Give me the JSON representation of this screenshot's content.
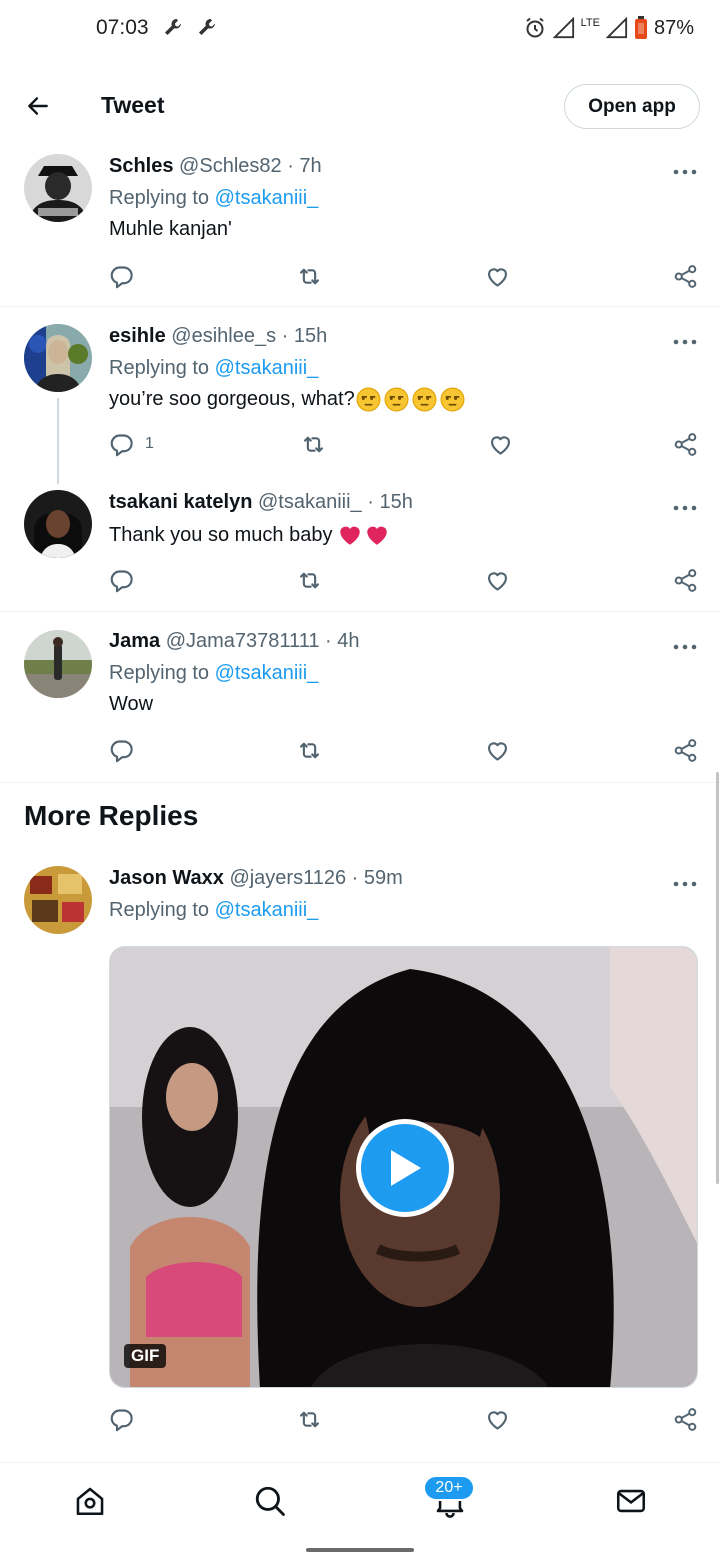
{
  "status_bar": {
    "time": "07:03",
    "battery": "87%",
    "network": "LTE"
  },
  "header": {
    "title": "Tweet",
    "open_app_label": "Open app"
  },
  "tweets": [
    {
      "name": "Schles",
      "handle": "@Schles82",
      "time": "· 7h",
      "replying_prefix": "Replying to ",
      "replying_handle": "@tsakaniii_",
      "text": "Muhle kanjan'",
      "reply_count": ""
    },
    {
      "name": "esihle",
      "handle": "@esihlee_s",
      "time": "· 15h",
      "replying_prefix": "Replying to ",
      "replying_handle": "@tsakaniii_",
      "text": "you’re soo gorgeous, what?",
      "emoji_count": 4,
      "reply_count": "1"
    },
    {
      "name": "tsakani katelyn",
      "handle": "@tsakaniii_",
      "time": "· 15h",
      "text": "Thank you so much baby",
      "hearts": 2,
      "reply_count": ""
    },
    {
      "name": "Jama",
      "handle": "@Jama73781111",
      "time": "· 4h",
      "replying_prefix": "Replying to ",
      "replying_handle": "@tsakaniii_",
      "text": "Wow",
      "reply_count": ""
    }
  ],
  "more_replies": {
    "title": "More Replies",
    "tweet": {
      "name": "Jason Waxx",
      "handle": "@jayers1126",
      "time": "· 59m",
      "replying_prefix": "Replying to ",
      "replying_handle": "@tsakaniii_",
      "media_badge": "GIF"
    }
  },
  "bottom_nav": {
    "notifications_badge": "20+"
  },
  "colors": {
    "accent": "#1d9bf0",
    "text": "#0f1419",
    "muted": "#536471",
    "border": "#eff3f4",
    "heart_red": "#e0245e"
  },
  "icons": [
    "arrow-left-icon",
    "wrench-icon",
    "alarm-icon",
    "signal-icon",
    "battery-icon",
    "more-icon",
    "reply-icon",
    "retweet-icon",
    "like-icon",
    "share-icon",
    "play-icon",
    "home-icon",
    "search-icon",
    "bell-icon",
    "mail-icon"
  ]
}
